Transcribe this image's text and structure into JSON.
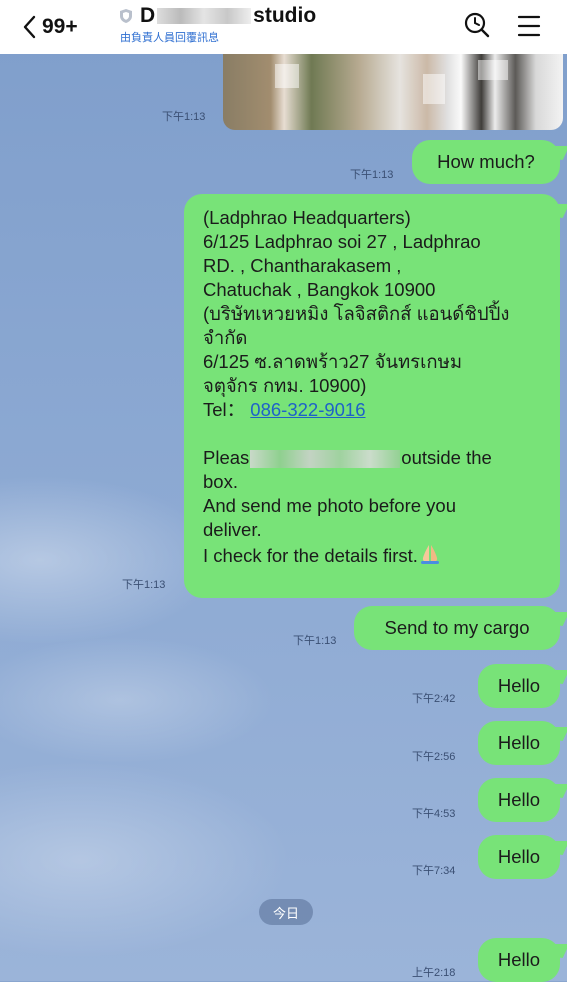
{
  "header": {
    "back_count": "99+",
    "title_start": "D",
    "title_end": "studio",
    "subtitle": "由負責人員回覆訊息"
  },
  "messages": [
    {
      "time": "下午1:13"
    },
    {
      "time": "下午1:13",
      "text": "How much?"
    },
    {
      "time": "下午1:13",
      "lines": [
        "(Ladphrao Headquarters)",
        "6/125 Ladphrao soi 27 , Ladphrao",
        "RD. , Chantharakasem ,",
        "Chatuchak , Bangkok 10900",
        "(บริษัทเหวยหมิง โลจิสติกส์ แอนด์ชิปปิ้ง",
        "จำกัด",
        "6/125 ซ.ลาดพร้าว27 จันทรเกษม",
        "จตุจักร กทม. 10900)"
      ],
      "tel_label": "Tel：",
      "tel_number": "086-322-9016",
      "please_start": "Pleas",
      "please_end": "outside the",
      "lines2": [
        "box.",
        "And send me photo before you",
        "deliver.",
        "I check for the details first."
      ]
    },
    {
      "time": "下午1:13",
      "text": "Send to my cargo"
    },
    {
      "time": "下午2:42",
      "text": "Hello"
    },
    {
      "time": "下午2:56",
      "text": "Hello"
    },
    {
      "time": "下午4:53",
      "text": "Hello"
    },
    {
      "time": "下午7:34",
      "text": "Hello"
    },
    {
      "time": "上午2:18",
      "text": "Hello"
    }
  ],
  "day_divider": "今日",
  "colors": {
    "bubble": "#78e378",
    "background": "#8aa6cf",
    "link": "#1e62c8"
  },
  "icons": [
    "chevron-left-icon",
    "shield-icon",
    "search-icon",
    "menu-icon",
    "pray-emoji-icon"
  ]
}
